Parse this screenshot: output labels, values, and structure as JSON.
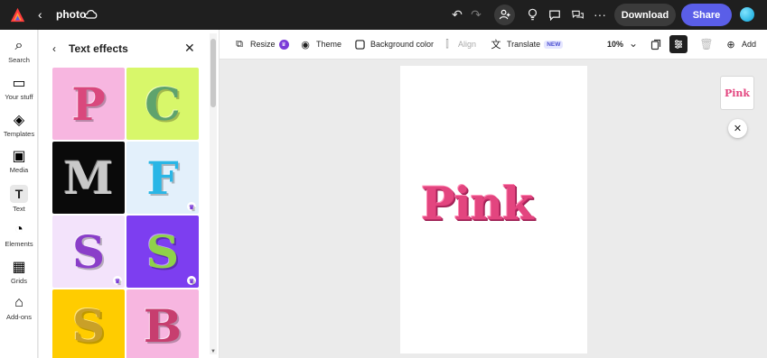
{
  "app": {
    "doc_title": "photo",
    "back_glyph": "‹",
    "download_label": "Download",
    "share_label": "Share",
    "more_glyph": "···"
  },
  "rail": [
    {
      "label": "Search",
      "icon": "search-icon",
      "glyph": "⌕"
    },
    {
      "label": "Your stuff",
      "icon": "folder-icon",
      "glyph": "▭"
    },
    {
      "label": "Templates",
      "icon": "templates-icon",
      "glyph": "◈"
    },
    {
      "label": "Media",
      "icon": "media-icon",
      "glyph": "▣"
    },
    {
      "label": "Text",
      "icon": "text-icon",
      "glyph": "T"
    },
    {
      "label": "Elements",
      "icon": "elements-icon",
      "glyph": "◔"
    },
    {
      "label": "Grids",
      "icon": "grids-icon",
      "glyph": "▦"
    },
    {
      "label": "Add-ons",
      "icon": "addons-icon",
      "glyph": "⌂"
    }
  ],
  "panel": {
    "back_glyph": "‹",
    "title": "Text effects",
    "close_glyph": "✕",
    "tiles": [
      {
        "letter": "P",
        "bg": "#f7b6e0",
        "fg": "#d9487d",
        "premium": false
      },
      {
        "letter": "C",
        "bg": "#d8f76a",
        "fg": "#5fa36d",
        "premium": false
      },
      {
        "letter": "M",
        "bg": "#0a0a0a",
        "fg": "#c9c9c9",
        "premium": false
      },
      {
        "letter": "F",
        "bg": "#e3f0fb",
        "fg": "#29b6e6",
        "premium": true
      },
      {
        "letter": "S",
        "bg": "#f3e3fb",
        "fg": "#8a3ec9",
        "premium": true
      },
      {
        "letter": "S",
        "bg": "#7d3ef0",
        "fg": "#8fd14a",
        "premium": true
      },
      {
        "letter": "S",
        "bg": "#ffcc00",
        "fg": "#c9a028",
        "premium": false
      },
      {
        "letter": "B",
        "bg": "#f7b6e0",
        "fg": "#c73e6f",
        "premium": false
      }
    ]
  },
  "toolbar": {
    "resize": "Resize",
    "theme": "Theme",
    "background_color": "Background color",
    "align": "Align",
    "translate": "Translate",
    "new_badge": "NEW",
    "zoom": "10%",
    "add": "Add",
    "chevron_glyph": "⌄"
  },
  "canvas": {
    "text": "Pink",
    "text_color": "#e3457f",
    "thumb_text": "Pink",
    "close_glyph": "✕"
  },
  "colors": {
    "brand_accent": "#5a5ee8",
    "topbar_bg": "#1f1f1f"
  }
}
